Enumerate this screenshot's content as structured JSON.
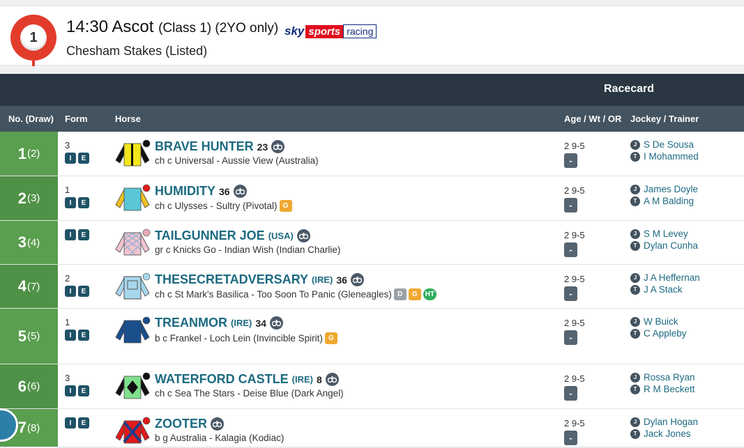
{
  "race": {
    "number": "1",
    "time": "14:30",
    "course": "Ascot",
    "class_info": "(Class 1) (2YO only)",
    "name": "Chesham Stakes (Listed)",
    "broadcaster": {
      "sky": "sky",
      "sports": "sports",
      "racing": "racing"
    }
  },
  "racecard": {
    "title": "Racecard",
    "columns": [
      "No. (Draw)",
      "Form",
      "Horse",
      "Age / Wt / OR",
      "Jockey / Trainer"
    ]
  },
  "runners": [
    {
      "no": "1",
      "draw": "(2)",
      "form": "3",
      "name": "BRAVE HUNTER",
      "country": "",
      "rating": "23",
      "breeding": "ch c Universal - Aussie View (Australia)",
      "tags": [],
      "age_wt": "2 9-5",
      "or": "-",
      "jockey": "S De Sousa",
      "trainer": "I Mohammed",
      "silk": {
        "body": "#f2e51b",
        "sleeve": "#111111",
        "cap": "#111111",
        "pattern": "stripes"
      }
    },
    {
      "no": "2",
      "draw": "(3)",
      "form": "1",
      "name": "HUMIDITY",
      "country": "",
      "rating": "36",
      "breeding": "ch c Ulysses - Sultry (Pivotal)",
      "tags": [
        "G"
      ],
      "age_wt": "2 9-5",
      "or": "-",
      "jockey": "James Doyle",
      "trainer": "A M Balding",
      "silk": {
        "body": "#5bc6d6",
        "sleeve": "#f2c020",
        "cap": "#e01b1b",
        "pattern": "plain"
      }
    },
    {
      "no": "3",
      "draw": "(4)",
      "form": "",
      "name": "TAILGUNNER JOE",
      "country": "(USA)",
      "rating": "",
      "breeding": "gr c Knicks Go - Indian Wish (Indian Charlie)",
      "tags": [],
      "age_wt": "2 9-5",
      "or": "-",
      "jockey": "S M Levey",
      "trainer": "Dylan Cunha",
      "silk": {
        "body": "#f1c4cf",
        "sleeve": "#f1c4cf",
        "cap": "#e7a9b6",
        "pattern": "diamonds"
      }
    },
    {
      "no": "4",
      "draw": "(7)",
      "form": "2",
      "name": "THESECRETADVERSARY",
      "country": "(IRE)",
      "rating": "36",
      "breeding": "ch c St Mark's Basilica - Too Soon To Panic (Gleneagles)",
      "tags": [
        "D",
        "G",
        "HT"
      ],
      "age_wt": "2 9-5",
      "or": "-",
      "jockey": "J A Heffernan",
      "trainer": "J A Stack",
      "silk": {
        "body": "#a8d6ec",
        "sleeve": "#a8d6ec",
        "cap": "#a8d6ec",
        "pattern": "box"
      }
    },
    {
      "no": "5",
      "draw": "(5)",
      "form": "1",
      "name": "TREANMOR",
      "country": "(IRE)",
      "rating": "34",
      "breeding": "b c Frankel - Loch Lein (Invincible Spirit)",
      "tags": [
        "G"
      ],
      "age_wt": "2 9-5",
      "or": "-",
      "jockey": "W Buick",
      "trainer": "C Appleby",
      "silk": {
        "body": "#1a4f8c",
        "sleeve": "#1a4f8c",
        "cap": "#1a4f8c",
        "pattern": "plain"
      }
    },
    {
      "no": "6",
      "draw": "(6)",
      "form": "3",
      "name": "WATERFORD CASTLE",
      "country": "(IRE)",
      "rating": "8",
      "breeding": "ch c Sea The Stars - Deise Blue (Dark Angel)",
      "tags": [],
      "age_wt": "2 9-5",
      "or": "-",
      "jockey": "Rossa Ryan",
      "trainer": "R M Beckett",
      "silk": {
        "body": "#7fe08c",
        "sleeve": "#111111",
        "cap": "#111111",
        "pattern": "diamond"
      }
    },
    {
      "no": "7",
      "draw": "(8)",
      "form": "",
      "name": "ZOOTER",
      "country": "",
      "rating": "",
      "breeding": "b g Australia - Kalagia (Kodiac)",
      "tags": [],
      "age_wt": "2 9-5",
      "or": "-",
      "jockey": "Dylan Hogan",
      "trainer": "Jack Jones",
      "silk": {
        "body": "#e01b1b",
        "sleeve": "#e01b1b",
        "cap": "#e01b1b",
        "pattern": "crossbelts"
      }
    }
  ],
  "form_badges": [
    "I",
    "E"
  ],
  "role_labels": {
    "jockey": "J",
    "trainer": "T"
  }
}
